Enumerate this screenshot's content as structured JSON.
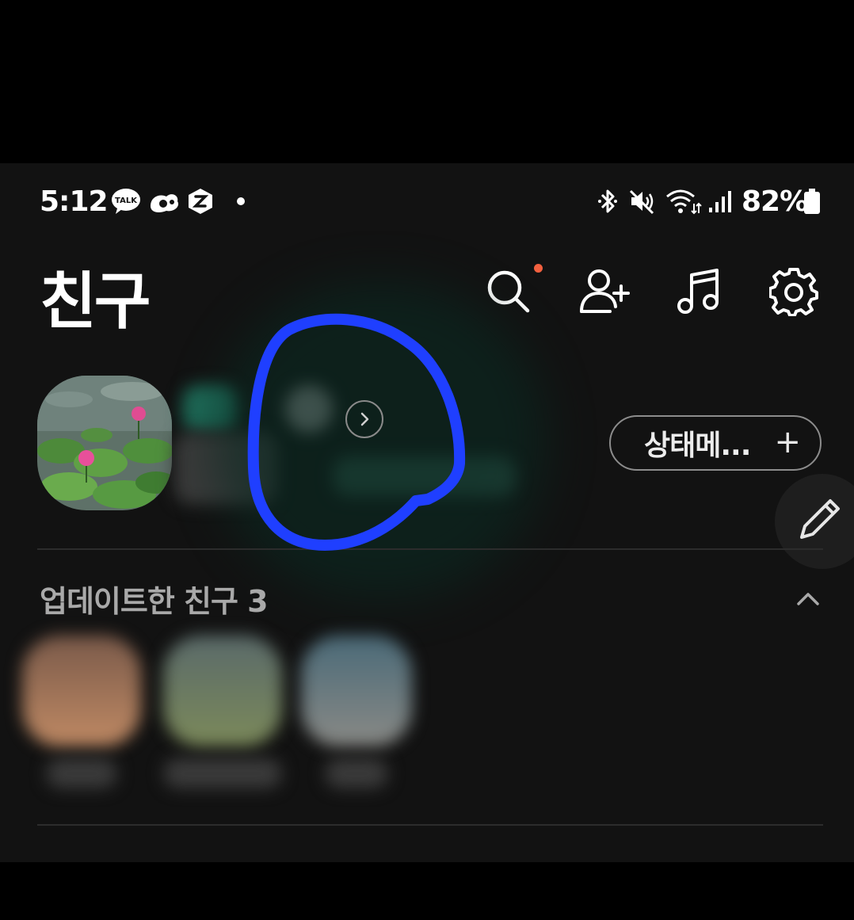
{
  "statusbar": {
    "time": "5:12",
    "notification_icons": [
      "kakaotalk-icon",
      "kakao-app-icon",
      "z-app-icon",
      "notification-dot-icon"
    ],
    "system_icons": [
      "bluetooth-icon",
      "mute-icon",
      "wifi-icon",
      "signal-icon"
    ],
    "battery_percent": "82%"
  },
  "header": {
    "title": "친구",
    "actions": [
      "search-icon",
      "add-friend-icon",
      "music-icon",
      "settings-icon"
    ],
    "search_has_badge": true,
    "badge_color": "#f2603f"
  },
  "profile": {
    "status_message_button": "상태메...",
    "status_add_symbol": "+"
  },
  "updated_friends": {
    "title": "업데이트한 친구 3",
    "count": 3,
    "collapsed": false
  },
  "annotation": {
    "shape": "hand-drawn circle",
    "color": "#1f3fff"
  }
}
